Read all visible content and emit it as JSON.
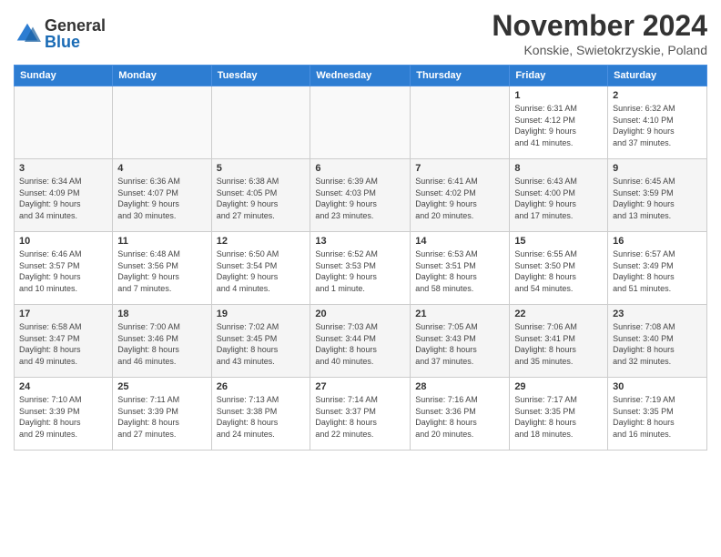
{
  "header": {
    "logo_line1": "General",
    "logo_line2": "Blue",
    "month_title": "November 2024",
    "location": "Konskie, Swietokrzyskie, Poland"
  },
  "days_of_week": [
    "Sunday",
    "Monday",
    "Tuesday",
    "Wednesday",
    "Thursday",
    "Friday",
    "Saturday"
  ],
  "weeks": [
    [
      {
        "day": "",
        "info": ""
      },
      {
        "day": "",
        "info": ""
      },
      {
        "day": "",
        "info": ""
      },
      {
        "day": "",
        "info": ""
      },
      {
        "day": "",
        "info": ""
      },
      {
        "day": "1",
        "info": "Sunrise: 6:31 AM\nSunset: 4:12 PM\nDaylight: 9 hours\nand 41 minutes."
      },
      {
        "day": "2",
        "info": "Sunrise: 6:32 AM\nSunset: 4:10 PM\nDaylight: 9 hours\nand 37 minutes."
      }
    ],
    [
      {
        "day": "3",
        "info": "Sunrise: 6:34 AM\nSunset: 4:09 PM\nDaylight: 9 hours\nand 34 minutes."
      },
      {
        "day": "4",
        "info": "Sunrise: 6:36 AM\nSunset: 4:07 PM\nDaylight: 9 hours\nand 30 minutes."
      },
      {
        "day": "5",
        "info": "Sunrise: 6:38 AM\nSunset: 4:05 PM\nDaylight: 9 hours\nand 27 minutes."
      },
      {
        "day": "6",
        "info": "Sunrise: 6:39 AM\nSunset: 4:03 PM\nDaylight: 9 hours\nand 23 minutes."
      },
      {
        "day": "7",
        "info": "Sunrise: 6:41 AM\nSunset: 4:02 PM\nDaylight: 9 hours\nand 20 minutes."
      },
      {
        "day": "8",
        "info": "Sunrise: 6:43 AM\nSunset: 4:00 PM\nDaylight: 9 hours\nand 17 minutes."
      },
      {
        "day": "9",
        "info": "Sunrise: 6:45 AM\nSunset: 3:59 PM\nDaylight: 9 hours\nand 13 minutes."
      }
    ],
    [
      {
        "day": "10",
        "info": "Sunrise: 6:46 AM\nSunset: 3:57 PM\nDaylight: 9 hours\nand 10 minutes."
      },
      {
        "day": "11",
        "info": "Sunrise: 6:48 AM\nSunset: 3:56 PM\nDaylight: 9 hours\nand 7 minutes."
      },
      {
        "day": "12",
        "info": "Sunrise: 6:50 AM\nSunset: 3:54 PM\nDaylight: 9 hours\nand 4 minutes."
      },
      {
        "day": "13",
        "info": "Sunrise: 6:52 AM\nSunset: 3:53 PM\nDaylight: 9 hours\nand 1 minute."
      },
      {
        "day": "14",
        "info": "Sunrise: 6:53 AM\nSunset: 3:51 PM\nDaylight: 8 hours\nand 58 minutes."
      },
      {
        "day": "15",
        "info": "Sunrise: 6:55 AM\nSunset: 3:50 PM\nDaylight: 8 hours\nand 54 minutes."
      },
      {
        "day": "16",
        "info": "Sunrise: 6:57 AM\nSunset: 3:49 PM\nDaylight: 8 hours\nand 51 minutes."
      }
    ],
    [
      {
        "day": "17",
        "info": "Sunrise: 6:58 AM\nSunset: 3:47 PM\nDaylight: 8 hours\nand 49 minutes."
      },
      {
        "day": "18",
        "info": "Sunrise: 7:00 AM\nSunset: 3:46 PM\nDaylight: 8 hours\nand 46 minutes."
      },
      {
        "day": "19",
        "info": "Sunrise: 7:02 AM\nSunset: 3:45 PM\nDaylight: 8 hours\nand 43 minutes."
      },
      {
        "day": "20",
        "info": "Sunrise: 7:03 AM\nSunset: 3:44 PM\nDaylight: 8 hours\nand 40 minutes."
      },
      {
        "day": "21",
        "info": "Sunrise: 7:05 AM\nSunset: 3:43 PM\nDaylight: 8 hours\nand 37 minutes."
      },
      {
        "day": "22",
        "info": "Sunrise: 7:06 AM\nSunset: 3:41 PM\nDaylight: 8 hours\nand 35 minutes."
      },
      {
        "day": "23",
        "info": "Sunrise: 7:08 AM\nSunset: 3:40 PM\nDaylight: 8 hours\nand 32 minutes."
      }
    ],
    [
      {
        "day": "24",
        "info": "Sunrise: 7:10 AM\nSunset: 3:39 PM\nDaylight: 8 hours\nand 29 minutes."
      },
      {
        "day": "25",
        "info": "Sunrise: 7:11 AM\nSunset: 3:39 PM\nDaylight: 8 hours\nand 27 minutes."
      },
      {
        "day": "26",
        "info": "Sunrise: 7:13 AM\nSunset: 3:38 PM\nDaylight: 8 hours\nand 24 minutes."
      },
      {
        "day": "27",
        "info": "Sunrise: 7:14 AM\nSunset: 3:37 PM\nDaylight: 8 hours\nand 22 minutes."
      },
      {
        "day": "28",
        "info": "Sunrise: 7:16 AM\nSunset: 3:36 PM\nDaylight: 8 hours\nand 20 minutes."
      },
      {
        "day": "29",
        "info": "Sunrise: 7:17 AM\nSunset: 3:35 PM\nDaylight: 8 hours\nand 18 minutes."
      },
      {
        "day": "30",
        "info": "Sunrise: 7:19 AM\nSunset: 3:35 PM\nDaylight: 8 hours\nand 16 minutes."
      }
    ]
  ]
}
